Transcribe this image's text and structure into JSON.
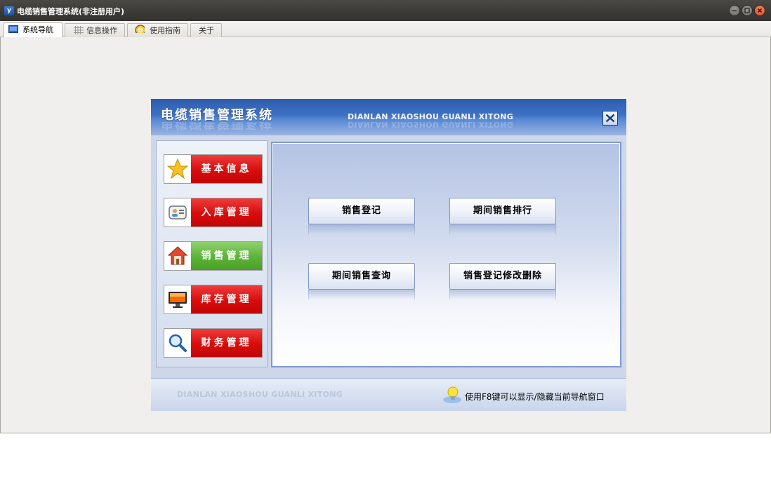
{
  "window": {
    "title": "电缆销售管理系统(非注册用户)",
    "app_icon_text": "y",
    "controls": [
      "minimize-icon",
      "maximize-icon",
      "close-icon"
    ]
  },
  "tabs": [
    {
      "label": "系统导航",
      "icon": "monitor-icon",
      "active": true
    },
    {
      "label": "信息操作",
      "icon": "grid-icon",
      "active": false
    },
    {
      "label": "使用指南",
      "icon": "help-icon",
      "active": false
    },
    {
      "label": "关于",
      "icon": "",
      "active": false
    }
  ],
  "panel": {
    "title": "电缆销售管理系统",
    "subtitle": "DIANLAN XIAOSHOU GUANLI XITONG",
    "menu": [
      {
        "label": "基本信息",
        "icon": "star-icon",
        "active": false
      },
      {
        "label": "入库管理",
        "icon": "contact-card-icon",
        "active": false
      },
      {
        "label": "销售管理",
        "icon": "home-icon",
        "active": true
      },
      {
        "label": "库存管理",
        "icon": "monitor-icon",
        "active": false
      },
      {
        "label": "财务管理",
        "icon": "magnifier-icon",
        "active": false
      }
    ],
    "actions": [
      {
        "label": "销售登记"
      },
      {
        "label": "期间销售排行"
      },
      {
        "label": "期间销售查询"
      },
      {
        "label": "销售登记修改删除"
      }
    ],
    "footer": {
      "watermark": "DIANLAN XIAOSHOU GUANLI XITONG",
      "tip": "使用F8键可以显示/隐藏当前导航窗口",
      "tip_icon": "lightbulb-icon"
    }
  },
  "colors": {
    "menu_red": "#d90c0c",
    "menu_green": "#5cb338",
    "header_blue": "#3f72c4"
  }
}
